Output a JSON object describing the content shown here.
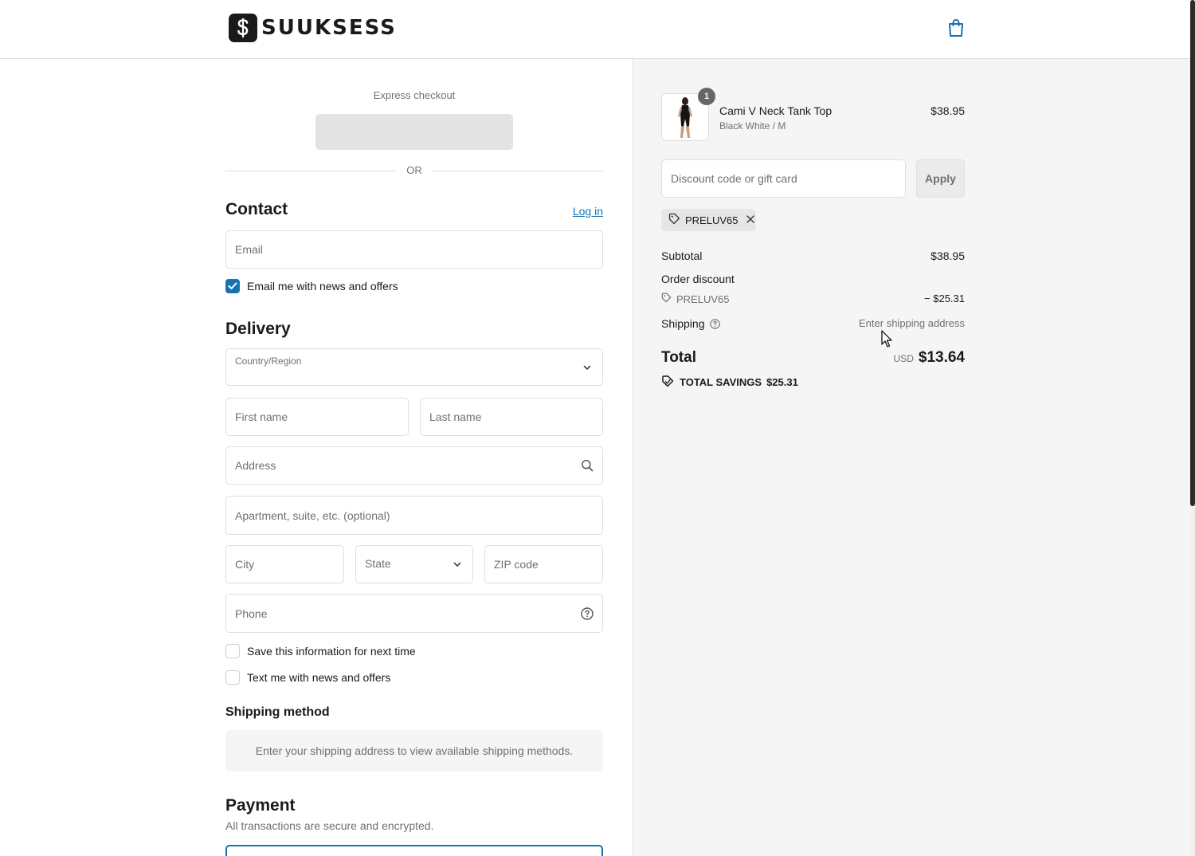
{
  "brand": {
    "name": "SUUKSESS",
    "logo_icon": "s-dollar-logo-icon"
  },
  "header": {
    "cart_icon": "shopping-bag-icon"
  },
  "express_checkout": {
    "label": "Express checkout",
    "divider_text": "OR"
  },
  "contact": {
    "heading": "Contact",
    "login_link": "Log in",
    "email_placeholder": "Email",
    "newsletter_label": "Email me with news and offers",
    "newsletter_checked": true
  },
  "delivery": {
    "heading": "Delivery",
    "country_label": "Country/Region",
    "country_value": "",
    "first_name_placeholder": "First name",
    "last_name_placeholder": "Last name",
    "address_placeholder": "Address",
    "apartment_placeholder": "Apartment, suite, etc. (optional)",
    "city_placeholder": "City",
    "state_placeholder": "State",
    "zip_placeholder": "ZIP code",
    "phone_placeholder": "Phone",
    "save_info_label": "Save this information for next time",
    "text_offers_label": "Text me with news and offers"
  },
  "shipping_method": {
    "heading": "Shipping method",
    "notice": "Enter your shipping address to view available shipping methods."
  },
  "payment": {
    "heading": "Payment",
    "subtext": "All transactions are secure and encrypted."
  },
  "order_summary": {
    "item": {
      "quantity": "1",
      "name": "Cami V Neck Tank Top",
      "variant": "Black White / M",
      "price": "$38.95"
    },
    "discount_input_placeholder": "Discount code or gift card",
    "apply_label": "Apply",
    "applied_code": "PRELUV65",
    "subtotal_label": "Subtotal",
    "subtotal_value": "$38.95",
    "order_discount_label": "Order discount",
    "discount_code": "PRELUV65",
    "discount_value": "− $25.31",
    "shipping_label": "Shipping",
    "shipping_value": "Enter shipping address",
    "total_label": "Total",
    "total_currency": "USD",
    "total_value": "$13.64",
    "savings_label": "TOTAL SAVINGS",
    "savings_value": "$25.31"
  },
  "colors": {
    "accent": "#1773b0",
    "summary_background": "#f5f5f5",
    "border": "#dedede"
  }
}
